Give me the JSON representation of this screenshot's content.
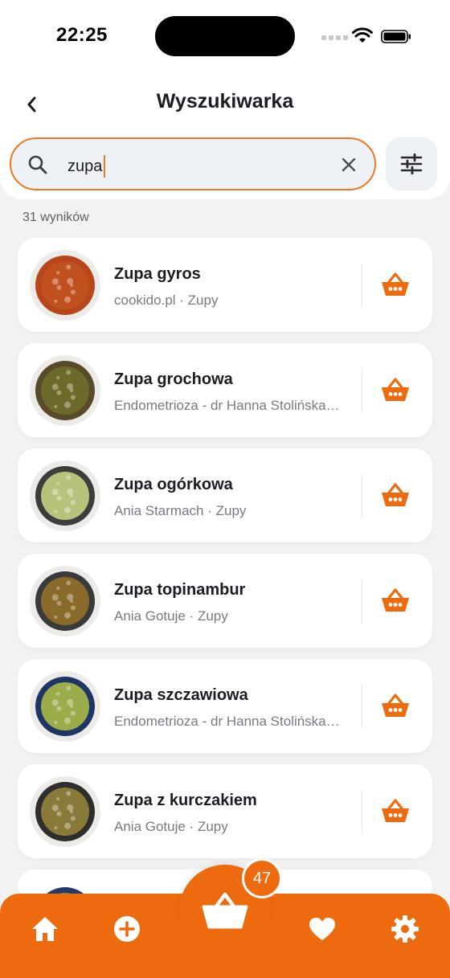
{
  "status_bar": {
    "time": "22:25"
  },
  "header": {
    "title": "Wyszukiwarka"
  },
  "search": {
    "value": "zupa"
  },
  "results": {
    "count_label": "31 wyników",
    "items": [
      {
        "name": "Zupa gyros",
        "meta": "cookido.pl · Zupy",
        "soup_color": "#c0501e",
        "bowl_color": "#b8461a"
      },
      {
        "name": "Zupa grochowa",
        "meta": "Endometrioza - dr Hanna Stolińska · Zupy",
        "soup_color": "#6b6a2a",
        "bowl_color": "#5a4a2c"
      },
      {
        "name": "Zupa ogórkowa",
        "meta": "Ania Starmach · Zupy",
        "soup_color": "#b7c27a",
        "bowl_color": "#3d3d3d"
      },
      {
        "name": "Zupa topinambur",
        "meta": "Ania Gotuje · Zupy",
        "soup_color": "#8a6a2a",
        "bowl_color": "#3a3a3a"
      },
      {
        "name": "Zupa szczawiowa",
        "meta": "Endometrioza - dr Hanna Stolińska · Zupy",
        "soup_color": "#9aad4a",
        "bowl_color": "#1f3566"
      },
      {
        "name": "Zupa z kurczakiem",
        "meta": "Ania Gotuje · Zupy",
        "soup_color": "#8a7a3a",
        "bowl_color": "#2e2e2e"
      }
    ]
  },
  "basket": {
    "badge_count": "47"
  },
  "colors": {
    "accent": "#ee6a0f",
    "search_border": "#ee7a22",
    "field_bg": "#eef1f6"
  },
  "icons": [
    "back-icon",
    "search-icon",
    "clear-icon",
    "filter-icon",
    "basket-icon",
    "home-icon",
    "plus-icon",
    "heart-icon",
    "gear-icon"
  ]
}
